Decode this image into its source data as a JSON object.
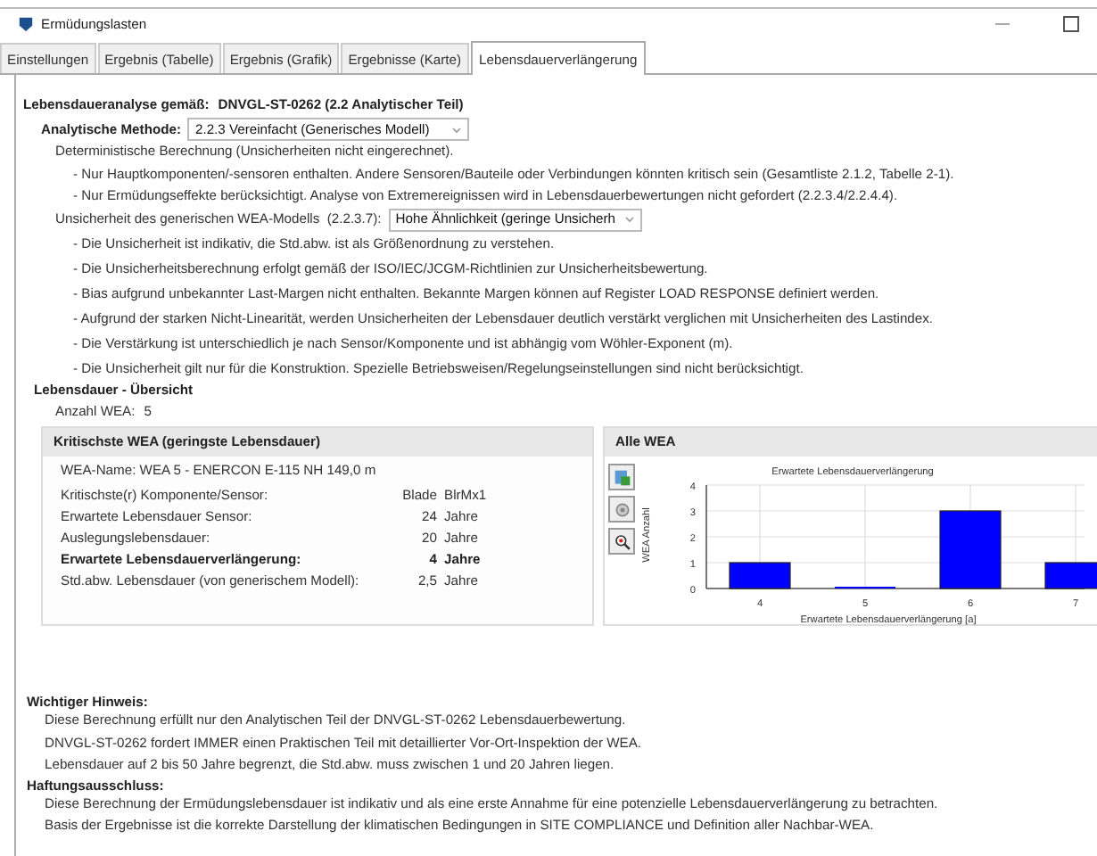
{
  "window": {
    "title": "Ermüdungslasten"
  },
  "tabs": [
    {
      "label": "Einstellungen",
      "selected": false
    },
    {
      "label": "Ergebnis (Tabelle)",
      "selected": false
    },
    {
      "label": "Ergebnis (Grafik)",
      "selected": false
    },
    {
      "label": "Ergebnisse (Karte)",
      "selected": false
    },
    {
      "label": "Lebensdauerverlängerung",
      "selected": true
    }
  ],
  "analysis": {
    "label": "Lebensdaueranalyse gemäß:",
    "standard": "DNVGL-ST-0262 (2.2 Analytischer Teil)"
  },
  "method": {
    "label": "Analytische Methode:",
    "value": "2.2.3 Vereinfacht (Generisches Modell)"
  },
  "deterministic": {
    "text": "Deterministische Berechnung (Unsicherheiten nicht eingerechnet).",
    "bullets": [
      "- Nur Hauptkomponenten/-sensoren enthalten. Andere Sensoren/Bauteile oder Verbindungen könnten kritisch sein (Gesamtliste 2.1.2, Tabelle 2-1).",
      "- Nur Ermüdungseffekte berücksichtigt. Analyse von Extremereignissen wird in Lebensdauerbewertungen nicht gefordert (2.2.3.4/2.2.4.4)."
    ]
  },
  "uncertainty": {
    "label": "Unsicherheit des generischen WEA-Modells  (2.2.3.7):",
    "value": "Hohe Ähnlichkeit (geringe Unsicherh",
    "bullets": [
      "- Die Unsicherheit ist indikativ, die Std.abw. ist als Größenordnung zu verstehen.",
      "- Die Unsicherheitsberechnung erfolgt gemäß der ISO/IEC/JCGM-Richtlinien zur Unsicherheitsbewertung.",
      "- Bias aufgrund unbekannter Last-Margen nicht enthalten. Bekannte Margen können auf Register LOAD RESPONSE definiert werden.",
      "- Aufgrund der starken Nicht-Linearität, werden Unsicherheiten der Lebensdauer deutlich verstärkt verglichen mit Unsicherheiten des Lastindex.",
      "- Die Verstärkung ist unterschiedlich je nach Sensor/Komponente und ist abhängig vom Wöhler-Exponent (m).",
      "- Die Unsicherheit gilt nur für die Konstruktion. Spezielle Betriebsweisen/Regelungseinstellungen sind nicht berücksichtigt."
    ]
  },
  "overview": {
    "title": "Lebensdauer - Übersicht",
    "count_label": "Anzahl WEA:",
    "count": "5"
  },
  "critical": {
    "title": "Kritischste WEA (geringste Lebensdauer)",
    "name": "WEA-Name: WEA 5 - ENERCON E-115 NH 149,0 m",
    "rows": [
      {
        "label": "Kritischste(r) Komponente/Sensor:",
        "value": "Blade",
        "unit": "BlrMx1",
        "bold": false
      },
      {
        "label": "Erwartete Lebensdauer Sensor:",
        "value": "24",
        "unit": "Jahre",
        "bold": false
      },
      {
        "label": "Auslegungslebensdauer:",
        "value": "20",
        "unit": "Jahre",
        "bold": false
      },
      {
        "label": "Erwartete Lebensdauerverlängerung:",
        "value": "4",
        "unit": "Jahre",
        "bold": true
      },
      {
        "label": "Std.abw. Lebensdauer (von generischem Modell):",
        "value": "2,5",
        "unit": "Jahre",
        "bold": false
      }
    ]
  },
  "all": {
    "title": "Alle WEA",
    "chart_data": {
      "type": "bar",
      "title": "Erwartete Lebensdauerverlängerung",
      "xlabel": "Erwartete Lebensdauerverlängerung [a]",
      "ylabel": "WEA Anzahl",
      "categories": [
        "4",
        "5",
        "6",
        "7"
      ],
      "series": [
        {
          "color": "#0000ff",
          "values": [
            1,
            0,
            3,
            1
          ]
        }
      ],
      "grid": true,
      "ylim": [
        0,
        4
      ],
      "yticks": [
        0,
        1,
        2,
        3,
        4
      ]
    }
  },
  "notice": {
    "title": "Wichtiger Hinweis:",
    "lines": [
      "Diese Berechnung erfüllt nur den Analytischen Teil der  DNVGL-ST-0262 Lebensdauerbewertung.",
      "DNVGL-ST-0262 fordert IMMER einen Praktischen Teil mit detaillierter Vor-Ort-Inspektion der WEA.",
      "Lebensdauer auf 2 bis 50 Jahre begrenzt, die Std.abw. muss zwischen 1 und 20 Jahren liegen."
    ]
  },
  "disclaimer": {
    "title": "Haftungsausschluss:",
    "lines": [
      "Diese Berechnung der Ermüdungslebensdauer ist indikativ und als eine erste Annahme für eine potenzielle Lebensdauerverlängerung zu betrachten.",
      "Basis der Ergebnisse ist die korrekte Darstellung der klimatischen Bedingungen in SITE COMPLIANCE und Definition aller Nachbar-WEA."
    ]
  }
}
